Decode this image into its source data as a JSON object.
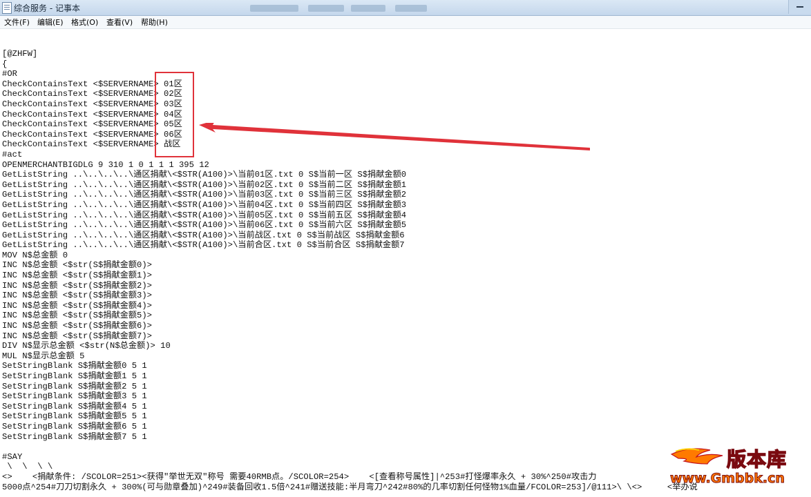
{
  "window": {
    "title": "综合服务 - 记事本"
  },
  "menu": [
    {
      "label": "文件(F)"
    },
    {
      "label": "编辑(E)"
    },
    {
      "label": "格式(O)"
    },
    {
      "label": "查看(V)"
    },
    {
      "label": "帮助(H)"
    }
  ],
  "document": {
    "lines": [
      "[@ZHFW]",
      "{",
      "#OR",
      "CheckContainsText <$SERVERNAME> 01区",
      "CheckContainsText <$SERVERNAME> 02区",
      "CheckContainsText <$SERVERNAME> 03区",
      "CheckContainsText <$SERVERNAME> 04区",
      "CheckContainsText <$SERVERNAME> 05区",
      "CheckContainsText <$SERVERNAME> 06区",
      "CheckContainsText <$SERVERNAME> 战区",
      "#act",
      "OPENMERCHANTBIGDLG 9 310 1 0 1 1 1 395 12",
      "GetListString ..\\..\\..\\..\\通区捐献\\<$STR(A100)>\\当前01区.txt 0 S$当前一区 S$捐献金额0",
      "GetListString ..\\..\\..\\..\\通区捐献\\<$STR(A100)>\\当前02区.txt 0 S$当前二区 S$捐献金额1",
      "GetListString ..\\..\\..\\..\\通区捐献\\<$STR(A100)>\\当前03区.txt 0 S$当前三区 S$捐献金额2",
      "GetListString ..\\..\\..\\..\\通区捐献\\<$STR(A100)>\\当前04区.txt 0 S$当前四区 S$捐献金额3",
      "GetListString ..\\..\\..\\..\\通区捐献\\<$STR(A100)>\\当前05区.txt 0 S$当前五区 S$捐献金额4",
      "GetListString ..\\..\\..\\..\\通区捐献\\<$STR(A100)>\\当前06区.txt 0 S$当前六区 S$捐献金额5",
      "GetListString ..\\..\\..\\..\\通区捐献\\<$STR(A100)>\\当前战区.txt 0 S$当前战区 S$捐献金额6",
      "GetListString ..\\..\\..\\..\\通区捐献\\<$STR(A100)>\\当前合区.txt 0 S$当前合区 S$捐献金额7",
      "MOV N$总金额 0",
      "INC N$总金额 <$str(S$捐献金额0)>",
      "INC N$总金额 <$str(S$捐献金额1)>",
      "INC N$总金额 <$str(S$捐献金额2)>",
      "INC N$总金额 <$str(S$捐献金额3)>",
      "INC N$总金额 <$str(S$捐献金额4)>",
      "INC N$总金额 <$str(S$捐献金额5)>",
      "INC N$总金额 <$str(S$捐献金额6)>",
      "INC N$总金额 <$str(S$捐献金额7)>",
      "DIV N$显示总金额 <$str(N$总金额)> 10",
      "MUL N$显示总金额 5",
      "SetStringBlank S$捐献金额0 5 1",
      "SetStringBlank S$捐献金额1 5 1",
      "SetStringBlank S$捐献金额2 5 1",
      "SetStringBlank S$捐献金额3 5 1",
      "SetStringBlank S$捐献金额4 5 1",
      "SetStringBlank S$捐献金额5 5 1",
      "SetStringBlank S$捐献金额6 5 1",
      "SetStringBlank S$捐献金额7 5 1",
      "",
      "#SAY",
      " \\  \\  \\ \\",
      "<>    <捐献条件: /SCOLOR=251><获得\"举世无双\"称号 需要40RMB点。/SCOLOR=254>    <[查看称号属性]|^253#打怪爆率永久 + 30%^250#攻击力",
      "5000点^254#刀刀切割永久 + 300%(可与勋章叠加)^249#装备回收1.5倍^241#赠送技能:半月弯刀^242#80%的几率切割任何怪物1%血量/FCOLOR=253]/@111>\\ \\<>     <举办说"
    ]
  },
  "watermark": {
    "brand": "版本库",
    "url": "www.Gmbbk.cn"
  },
  "colors": {
    "highlight": "#e0323a",
    "logo_orange": "#ff7a00",
    "logo_red": "#c1121f"
  }
}
